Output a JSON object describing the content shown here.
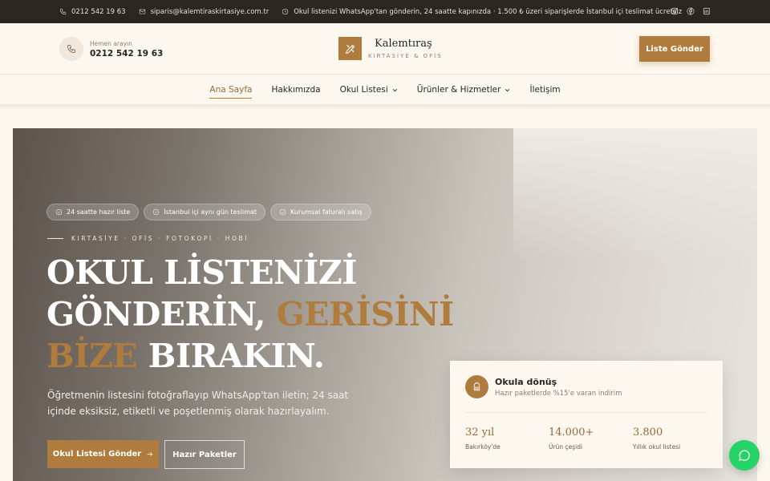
{
  "topbar": {
    "phone": "0212 542 19 63",
    "email": "siparis@kalemtiraskirtasiye.com.tr",
    "notice": "Okul listenizi WhatsApp'tan gönderin, 24 saatte kapınızda · 1.500 ₺ üzeri siparişlerde İstanbul içi teslimat ücretsiz",
    "social_icons": [
      "instagram-icon",
      "facebook-icon",
      "linkedin-icon"
    ]
  },
  "header": {
    "call_label": "Hemen arayın",
    "call_number": "0212 542 19 63",
    "brand_name": "Kalemtıraş",
    "brand_tagline": "KIRTASİYE & OFİS",
    "cta_label": "Liste Gönder"
  },
  "nav": {
    "items": [
      {
        "label": "Ana Sayfa",
        "active": true
      },
      {
        "label": "Hakkımızda"
      },
      {
        "label": "Okul Listesi",
        "dropdown": true
      },
      {
        "label": "Ürünler & Hizmetler",
        "dropdown": true
      },
      {
        "label": "İletişim"
      }
    ]
  },
  "hero": {
    "chips": [
      "24 saatte hazır liste",
      "İstanbul içi aynı gün teslimat",
      "Kurumsal faturalı satış"
    ],
    "eyebrow": "KIRTASİYE · OFİS · FOTOKOPİ · HOBİ",
    "headline_line1": "OKUL LİSTENİZİ",
    "headline_line2_a": "GÖNDERİN, ",
    "headline_line2_b": "GERİSİNİ",
    "headline_line3_a": "BİZE",
    "headline_line3_b": " BIRAKIN.",
    "lead": "Öğretmenin listesini fotoğraflayıp WhatsApp'tan iletin; 24 saat içinde eksiksiz, etiketli ve poşetlenmiş olarak hazırlayalım.",
    "primary_button": "Okul Listesi Gönder",
    "secondary_button": "Hazır Paketler"
  },
  "promo_card": {
    "title": "Okula dönüş",
    "description": "Hazır paketlerde %15'e varan indirim",
    "stats": [
      {
        "value": "32 yıl",
        "label": "Bakırköy'de"
      },
      {
        "value": "14.000+",
        "label": "Ürün çeşidi"
      },
      {
        "value": "3.800",
        "label": "Yıllık okul listesi"
      }
    ]
  },
  "colors": {
    "accent": "#b07c3e",
    "topbar_bg": "#2a2622",
    "page_bg": "#fcf8f0",
    "whatsapp": "#25d366"
  }
}
